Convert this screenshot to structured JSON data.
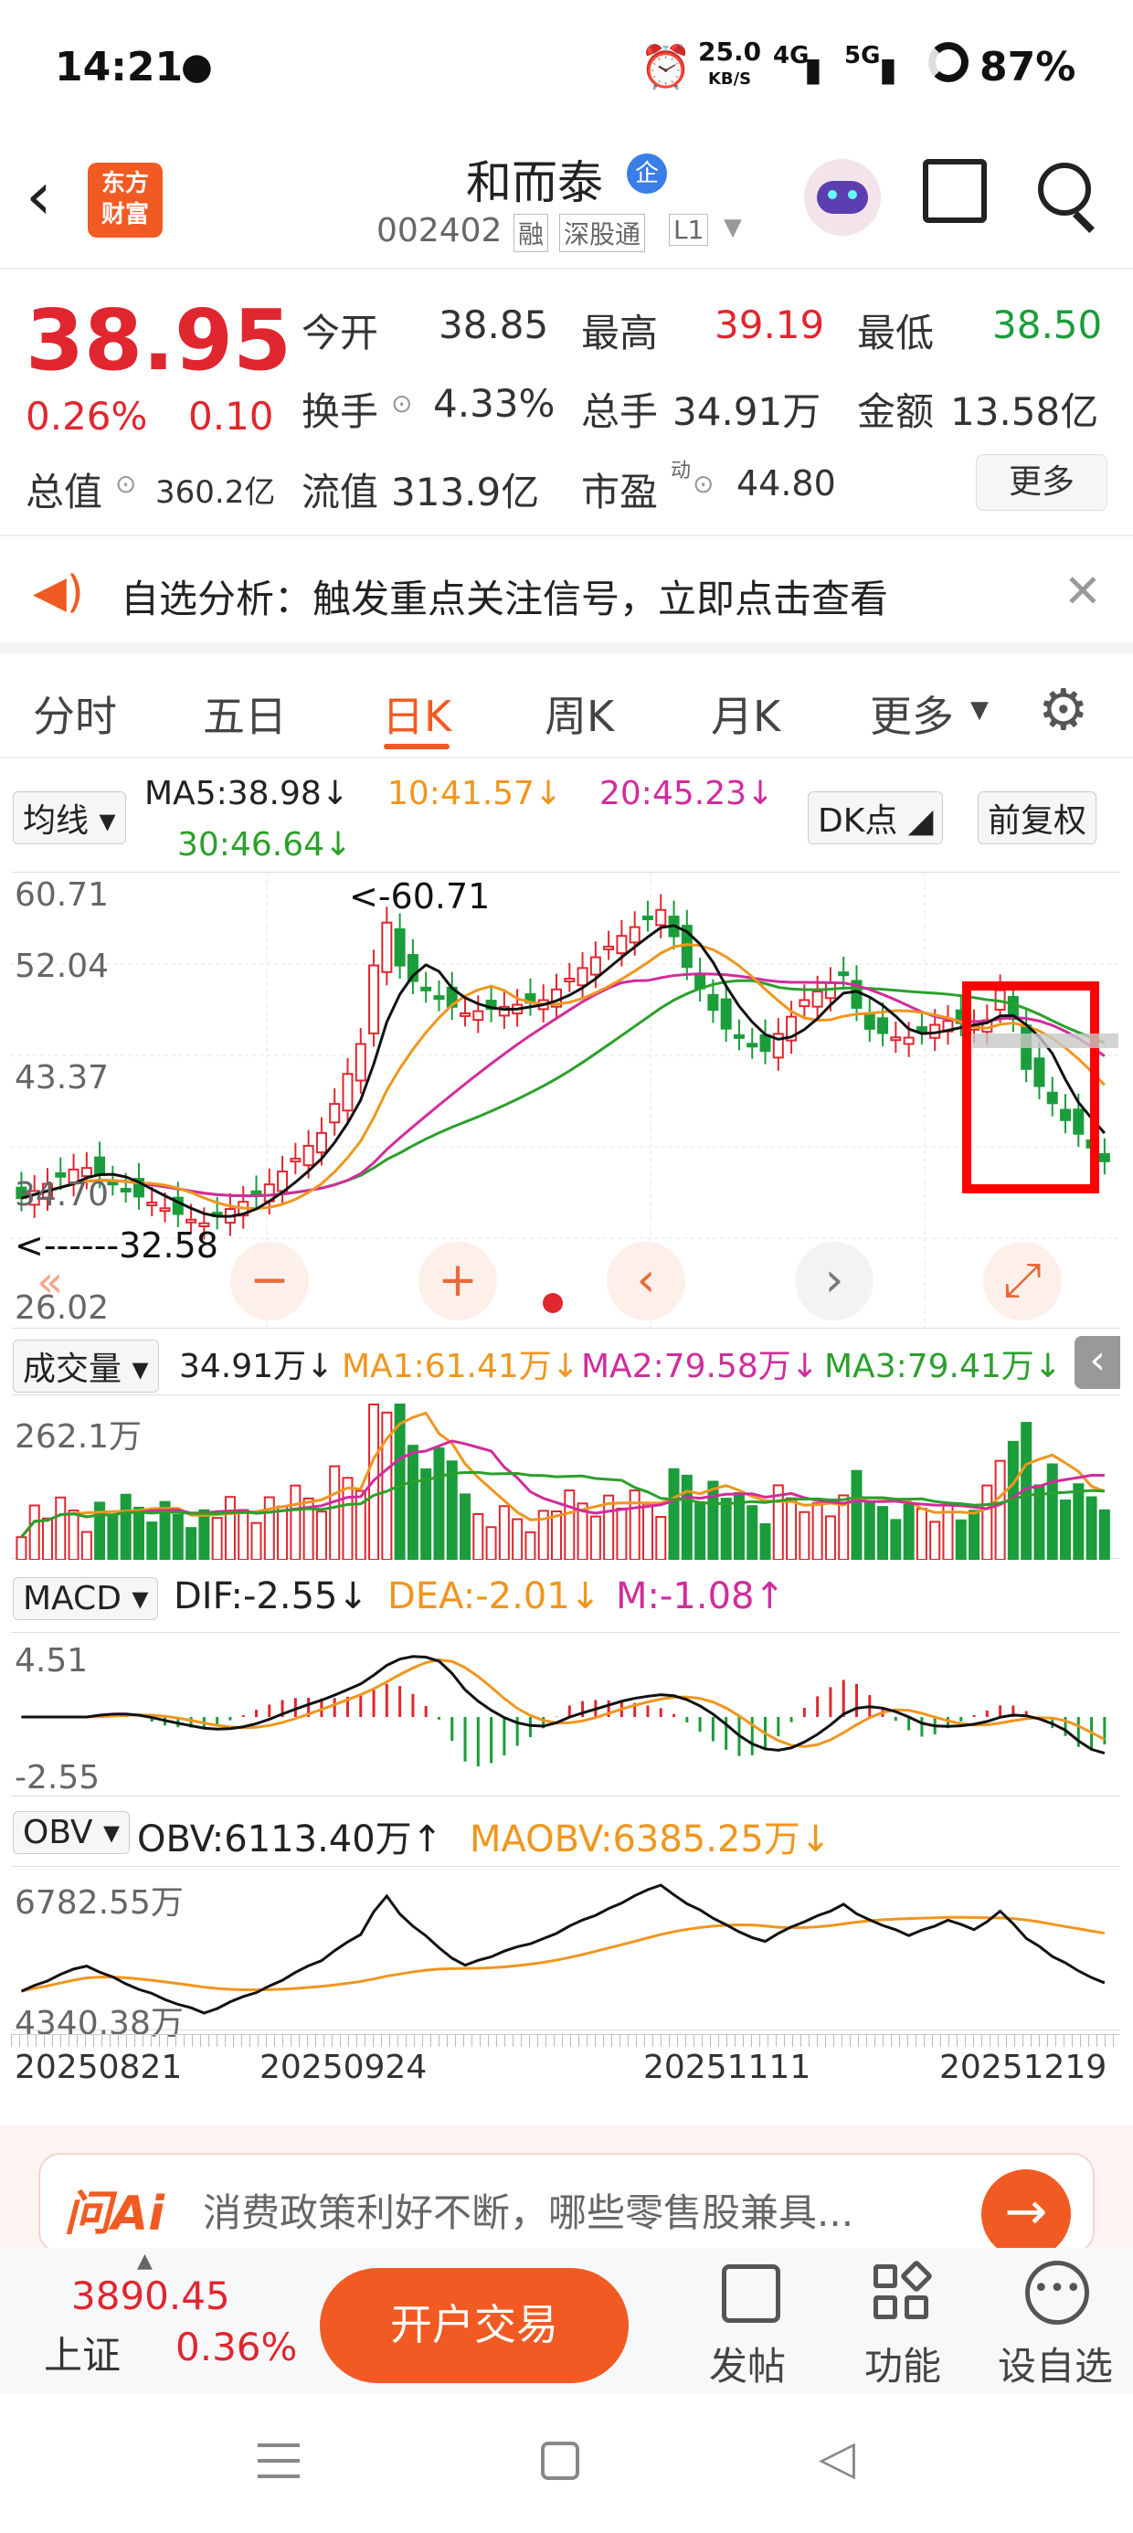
{
  "status": {
    "time": "14:21",
    "speed_value": "25.0",
    "speed_unit": "KB/S",
    "net1": "4G",
    "net2": "5G",
    "battery": "87%"
  },
  "header": {
    "name": "和而泰",
    "badge": "企",
    "code": "002402",
    "tags": [
      "融",
      "深股通",
      "L1"
    ],
    "logo_line1": "东方",
    "logo_line2": "财富"
  },
  "quote": {
    "price": "38.95",
    "pct": "0.26%",
    "chg": "0.10",
    "open_label": "今开",
    "open": "38.85",
    "high_label": "最高",
    "high": "39.19",
    "low_label": "最低",
    "low": "38.50",
    "turnover_label": "换手",
    "turnover": "4.33%",
    "volume_label": "总手",
    "volume": "34.91万",
    "amount_label": "金额",
    "amount": "13.58亿",
    "mcap_label": "总值",
    "mcap": "360.2亿",
    "float_label": "流值",
    "float": "313.9亿",
    "pe_label": "市盈",
    "pe_sup": "动",
    "pe": "44.80",
    "more": "更多"
  },
  "notice": {
    "text": "自选分析：触发重点关注信号，立即点击查看"
  },
  "tabs": [
    "分时",
    "五日",
    "日K",
    "周K",
    "月K",
    "更多"
  ],
  "active_tab": 2,
  "kline": {
    "selector": "均线",
    "ma5": "MA5:38.98↓",
    "ma10": "10:41.57↓",
    "ma20": "20:45.23↓",
    "ma30": "30:46.64↓",
    "dk": "DK点",
    "fq": "前复权",
    "y_labels": [
      "60.71",
      "52.04",
      "43.37",
      "34.70",
      "26.02"
    ],
    "max_label": "<-60.71",
    "min_label": "<------32.58"
  },
  "volume": {
    "selector": "成交量",
    "value": "34.91万↓",
    "ma1": "MA1:61.41万↓",
    "ma2": "MA2:79.58万↓",
    "ma3": "MA3:79.41万↓",
    "top": "262.1万"
  },
  "macd": {
    "selector": "MACD",
    "dif": "DIF:-2.55↓",
    "dea": "DEA:-2.01↓",
    "m": "M:-1.08↑",
    "top": "4.51",
    "bottom": "-2.55"
  },
  "obv": {
    "selector": "OBV",
    "obv": "OBV:6113.40万↑",
    "maobv": "MAOBV:6385.25万↓",
    "top": "6782.55万",
    "bottom": "4340.38万"
  },
  "dates": [
    "20250821",
    "20250924",
    "20251111",
    "20251219"
  ],
  "ai": {
    "brand": "问Ai",
    "text": "消费政策利好不断，哪些零售股兼具..."
  },
  "bottom": {
    "index_value": "3890.45",
    "index_name": "上证",
    "index_pct": "0.36%",
    "trade": "开户交易",
    "post": "发帖",
    "func": "功能",
    "watch": "设自选"
  },
  "colors": {
    "up": "#e0262e",
    "down": "#1a9d3a",
    "accent": "#f15a22",
    "ma5": "#111111",
    "ma10": "#f0961e",
    "ma20": "#d12c9c",
    "ma30": "#2ba02b"
  }
}
